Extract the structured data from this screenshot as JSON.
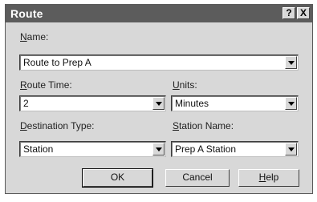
{
  "window": {
    "title": "Route",
    "help_button": "?",
    "close_button": "X"
  },
  "name": {
    "label_underlined": "N",
    "label_rest": "ame:",
    "value": "Route to Prep A"
  },
  "route_time": {
    "label_underlined": "R",
    "label_rest": "oute Time:",
    "value": "2"
  },
  "units": {
    "label_underlined": "U",
    "label_rest": "nits:",
    "value": "Minutes"
  },
  "destination_type": {
    "label_underlined": "D",
    "label_rest": "estination Type:",
    "value": "Station"
  },
  "station_name": {
    "label_underlined": "S",
    "label_rest": "tation Name:",
    "value": "Prep A Station"
  },
  "buttons": {
    "ok": "OK",
    "cancel": "Cancel",
    "help_underlined": "H",
    "help_rest": "elp"
  }
}
